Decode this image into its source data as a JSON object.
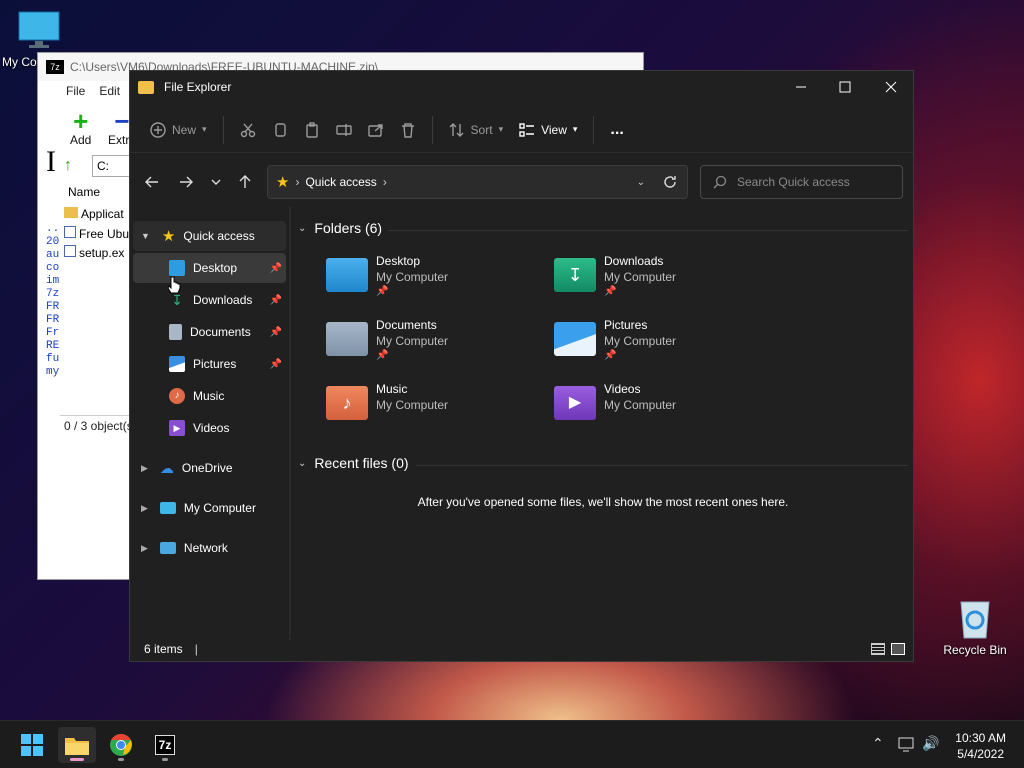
{
  "desktop": {
    "my_computer_label": "My Co",
    "recycle_bin_label": "Recycle Bin"
  },
  "zip_window": {
    "title": "C:\\Users\\VM6\\Downloads\\FREE-UBUNTU-MACHINE.zip\\",
    "menu": [
      "File",
      "Edit"
    ],
    "add_label": "Add",
    "extract_label": "Extra",
    "path_partial": "C:",
    "name_header": "Name",
    "files": [
      "Applicat",
      "Free Ubu",
      "setup.ex"
    ],
    "left_glyph": "I",
    "left_lines": [
      "..",
      "20",
      "au",
      "co",
      "im",
      "7z",
      "FR",
      "FR",
      "Fr",
      "RE",
      "fu",
      "my"
    ],
    "status": "0 / 3 object(s"
  },
  "explorer": {
    "title": "File Explorer",
    "commands": {
      "new": "New",
      "sort": "Sort",
      "view": "View",
      "more": "..."
    },
    "address": {
      "crumb": "Quick access"
    },
    "search_placeholder": "Search Quick access",
    "sidebar": {
      "quick_access": "Quick access",
      "pinned": [
        "Desktop",
        "Downloads",
        "Documents",
        "Pictures"
      ],
      "other": [
        "Music",
        "Videos"
      ],
      "roots": [
        "OneDrive",
        "My Computer",
        "Network"
      ]
    },
    "folders_header": "Folders (6)",
    "folders": [
      {
        "name": "Desktop",
        "location": "My Computer",
        "color": "#3aa0e0"
      },
      {
        "name": "Downloads",
        "location": "My Computer",
        "color": "#1e9e76"
      },
      {
        "name": "Documents",
        "location": "My Computer",
        "color": "#8ea2b8"
      },
      {
        "name": "Pictures",
        "location": "My Computer",
        "color": "#3a8ee0"
      },
      {
        "name": "Music",
        "location": "My Computer",
        "color": "#e0724a"
      },
      {
        "name": "Videos",
        "location": "My Computer",
        "color": "#8a4ed0"
      }
    ],
    "recent_header": "Recent files (0)",
    "recent_empty": "After you've opened some files, we'll show the most recent ones here.",
    "status_items": "6 items"
  },
  "taskbar": {
    "time": "10:30 AM",
    "date": "5/4/2022",
    "seven_zip_label": "7z"
  }
}
